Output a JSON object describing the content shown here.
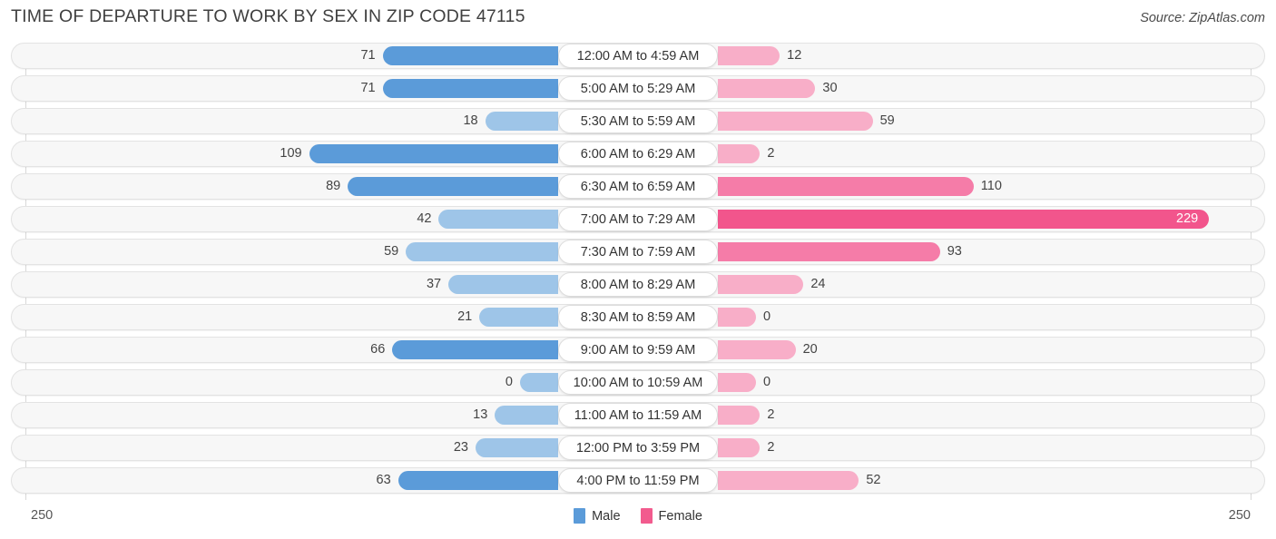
{
  "header": {
    "title": "TIME OF DEPARTURE TO WORK BY SEX IN ZIP CODE 47115",
    "source": "Source: ZipAtlas.com"
  },
  "legend": {
    "male_label": "Male",
    "female_label": "Female",
    "male_color": "#5b9bd9",
    "female_color": "#f25b8e"
  },
  "axis": {
    "left_max": "250",
    "right_max": "250"
  },
  "chart_data": {
    "type": "bar",
    "orientation": "horizontal-diverging",
    "title": "TIME OF DEPARTURE TO WORK BY SEX IN ZIP CODE 47115",
    "xlabel": "",
    "ylabel": "",
    "xlim": [
      250,
      250
    ],
    "grid": false,
    "legend_position": "bottom-center",
    "categories": [
      "12:00 AM to 4:59 AM",
      "5:00 AM to 5:29 AM",
      "5:30 AM to 5:59 AM",
      "6:00 AM to 6:29 AM",
      "6:30 AM to 6:59 AM",
      "7:00 AM to 7:29 AM",
      "7:30 AM to 7:59 AM",
      "8:00 AM to 8:29 AM",
      "8:30 AM to 8:59 AM",
      "9:00 AM to 9:59 AM",
      "10:00 AM to 10:59 AM",
      "11:00 AM to 11:59 AM",
      "12:00 PM to 3:59 PM",
      "4:00 PM to 11:59 PM"
    ],
    "series": [
      {
        "name": "Male",
        "values": [
          71,
          71,
          18,
          109,
          89,
          42,
          59,
          37,
          21,
          66,
          0,
          13,
          23,
          63
        ]
      },
      {
        "name": "Female",
        "values": [
          12,
          30,
          59,
          2,
          110,
          229,
          93,
          24,
          0,
          20,
          0,
          2,
          2,
          52
        ]
      }
    ]
  },
  "rows": [
    {
      "label": "12:00 AM to 4:59 AM",
      "male": "71",
      "female": "12",
      "male_v": 71,
      "female_v": 12
    },
    {
      "label": "5:00 AM to 5:29 AM",
      "male": "71",
      "female": "30",
      "male_v": 71,
      "female_v": 30
    },
    {
      "label": "5:30 AM to 5:59 AM",
      "male": "18",
      "female": "59",
      "male_v": 18,
      "female_v": 59
    },
    {
      "label": "6:00 AM to 6:29 AM",
      "male": "109",
      "female": "2",
      "male_v": 109,
      "female_v": 2
    },
    {
      "label": "6:30 AM to 6:59 AM",
      "male": "89",
      "female": "110",
      "male_v": 89,
      "female_v": 110
    },
    {
      "label": "7:00 AM to 7:29 AM",
      "male": "42",
      "female": "229",
      "male_v": 42,
      "female_v": 229
    },
    {
      "label": "7:30 AM to 7:59 AM",
      "male": "59",
      "female": "93",
      "male_v": 59,
      "female_v": 93
    },
    {
      "label": "8:00 AM to 8:29 AM",
      "male": "37",
      "female": "24",
      "male_v": 37,
      "female_v": 24
    },
    {
      "label": "8:30 AM to 8:59 AM",
      "male": "21",
      "female": "0",
      "male_v": 21,
      "female_v": 0
    },
    {
      "label": "9:00 AM to 9:59 AM",
      "male": "66",
      "female": "20",
      "male_v": 66,
      "female_v": 20
    },
    {
      "label": "10:00 AM to 10:59 AM",
      "male": "0",
      "female": "0",
      "male_v": 0,
      "female_v": 0
    },
    {
      "label": "11:00 AM to 11:59 AM",
      "male": "13",
      "female": "2",
      "male_v": 13,
      "female_v": 2
    },
    {
      "label": "12:00 PM to 3:59 PM",
      "male": "23",
      "female": "2",
      "male_v": 23,
      "female_v": 2
    },
    {
      "label": "4:00 PM to 11:59 PM",
      "male": "63",
      "female": "52",
      "male_v": 63,
      "female_v": 52
    }
  ]
}
